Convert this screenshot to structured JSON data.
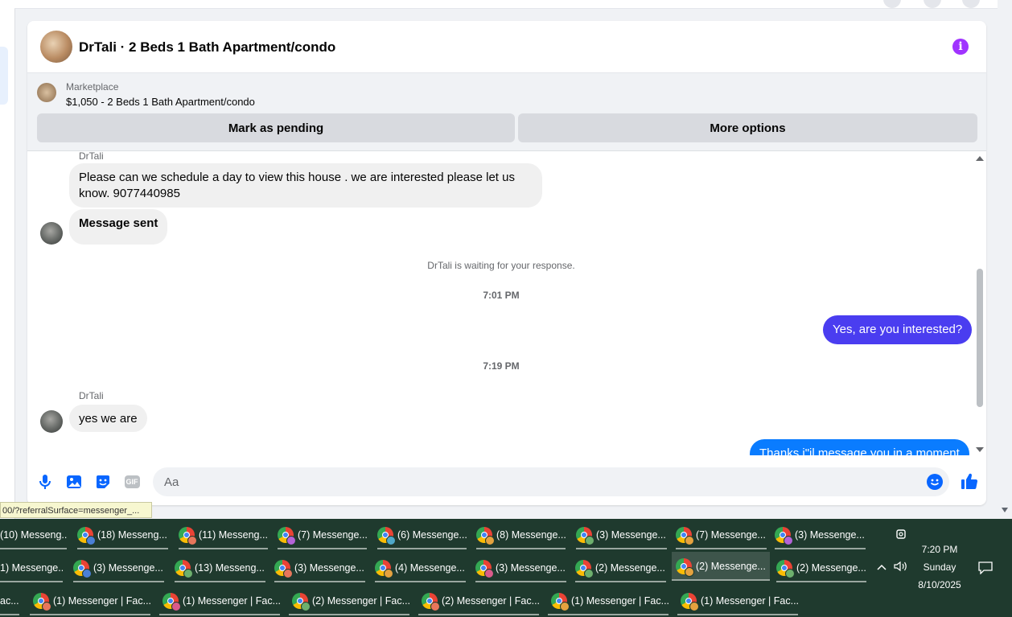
{
  "header": {
    "title": "DrTali · 2 Beds 1 Bath Apartment/condo",
    "info_icon": "i"
  },
  "listing": {
    "label": "Marketplace",
    "price_title": "$1,050 - 2 Beds 1 Bath Apartment/condo",
    "mark_pending": "Mark as pending",
    "more_options": "More options"
  },
  "messages": {
    "sender1": "DrTali",
    "msg1": "Please can we schedule a day to view this house . we are interested  please let us know. 9077440985",
    "msg2": "Message sent",
    "waiting": "DrTali is waiting for your response.",
    "time1": "7:01 PM",
    "out1": "Yes, are you interested?",
    "time2": "7:19 PM",
    "sender2": "DrTali",
    "msg3": "yes we are",
    "out2": "Thanks i\"il message you in a moment"
  },
  "composer": {
    "placeholder": "Aa",
    "gif": "GIF"
  },
  "colors": {
    "accent": "#0866ff",
    "out_bubble_1": "#4a3df0",
    "out_bubble_2": "#0a7cff",
    "info": "#a033ff",
    "taskbar": "#1f3a2e"
  },
  "status_url": "00/?referralSurface=messenger_...",
  "taskbar": {
    "row1": [
      "(10) Messeng...",
      "(18) Messeng...",
      "(11) Messeng...",
      "(7) Messenge...",
      "(6) Messenge...",
      "(8) Messenge...",
      "(3) Messenge...",
      "(7) Messenge...",
      "(3) Messenge..."
    ],
    "row2": [
      "1) Messenge...",
      "(3) Messenge...",
      "(13) Messeng...",
      "(3) Messenge...",
      "(4) Messenge...",
      "(3) Messenge...",
      "(2) Messenge...",
      "(2) Messenge...",
      "(2) Messenge..."
    ],
    "row3": [
      "ac...",
      "(1) Messenger | Fac...",
      "(1) Messenger | Fac...",
      "(2) Messenger | Fac...",
      "(2) Messenger | Fac...",
      "(1) Messenger | Fac...",
      "(1) Messenger | Fac..."
    ],
    "time": "7:20 PM",
    "day": "Sunday",
    "date": "8/10/2025"
  }
}
